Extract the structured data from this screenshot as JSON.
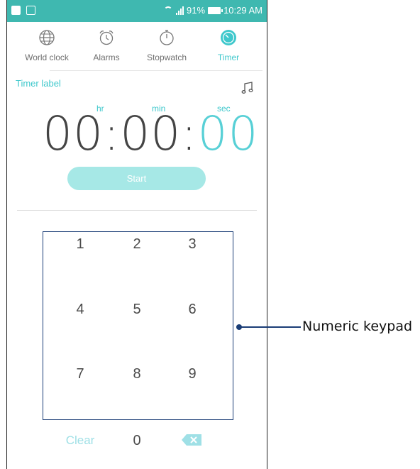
{
  "statusbar": {
    "battery": "91%",
    "time": "10:29 AM"
  },
  "tabs": [
    {
      "label": "World clock",
      "icon": "globe-icon"
    },
    {
      "label": "Alarms",
      "icon": "alarm-clock-icon"
    },
    {
      "label": "Stopwatch",
      "icon": "stopwatch-icon"
    },
    {
      "label": "Timer",
      "icon": "timer-icon",
      "active": true
    }
  ],
  "timer": {
    "label": "Timer label",
    "units": {
      "hr": "hr",
      "min": "min",
      "sec": "sec"
    },
    "hours": "00",
    "minutes": "00",
    "seconds": "00",
    "sep": ":",
    "start_label": "Start"
  },
  "keypad": {
    "keys": [
      "1",
      "2",
      "3",
      "4",
      "5",
      "6",
      "7",
      "8",
      "9"
    ],
    "clear_label": "Clear",
    "zero": "0"
  },
  "callout": {
    "text": "Numeric keypad"
  },
  "colors": {
    "accent": "#3fc8cc",
    "statusbar": "#3fb8b0",
    "callout": "#1a3d76"
  }
}
